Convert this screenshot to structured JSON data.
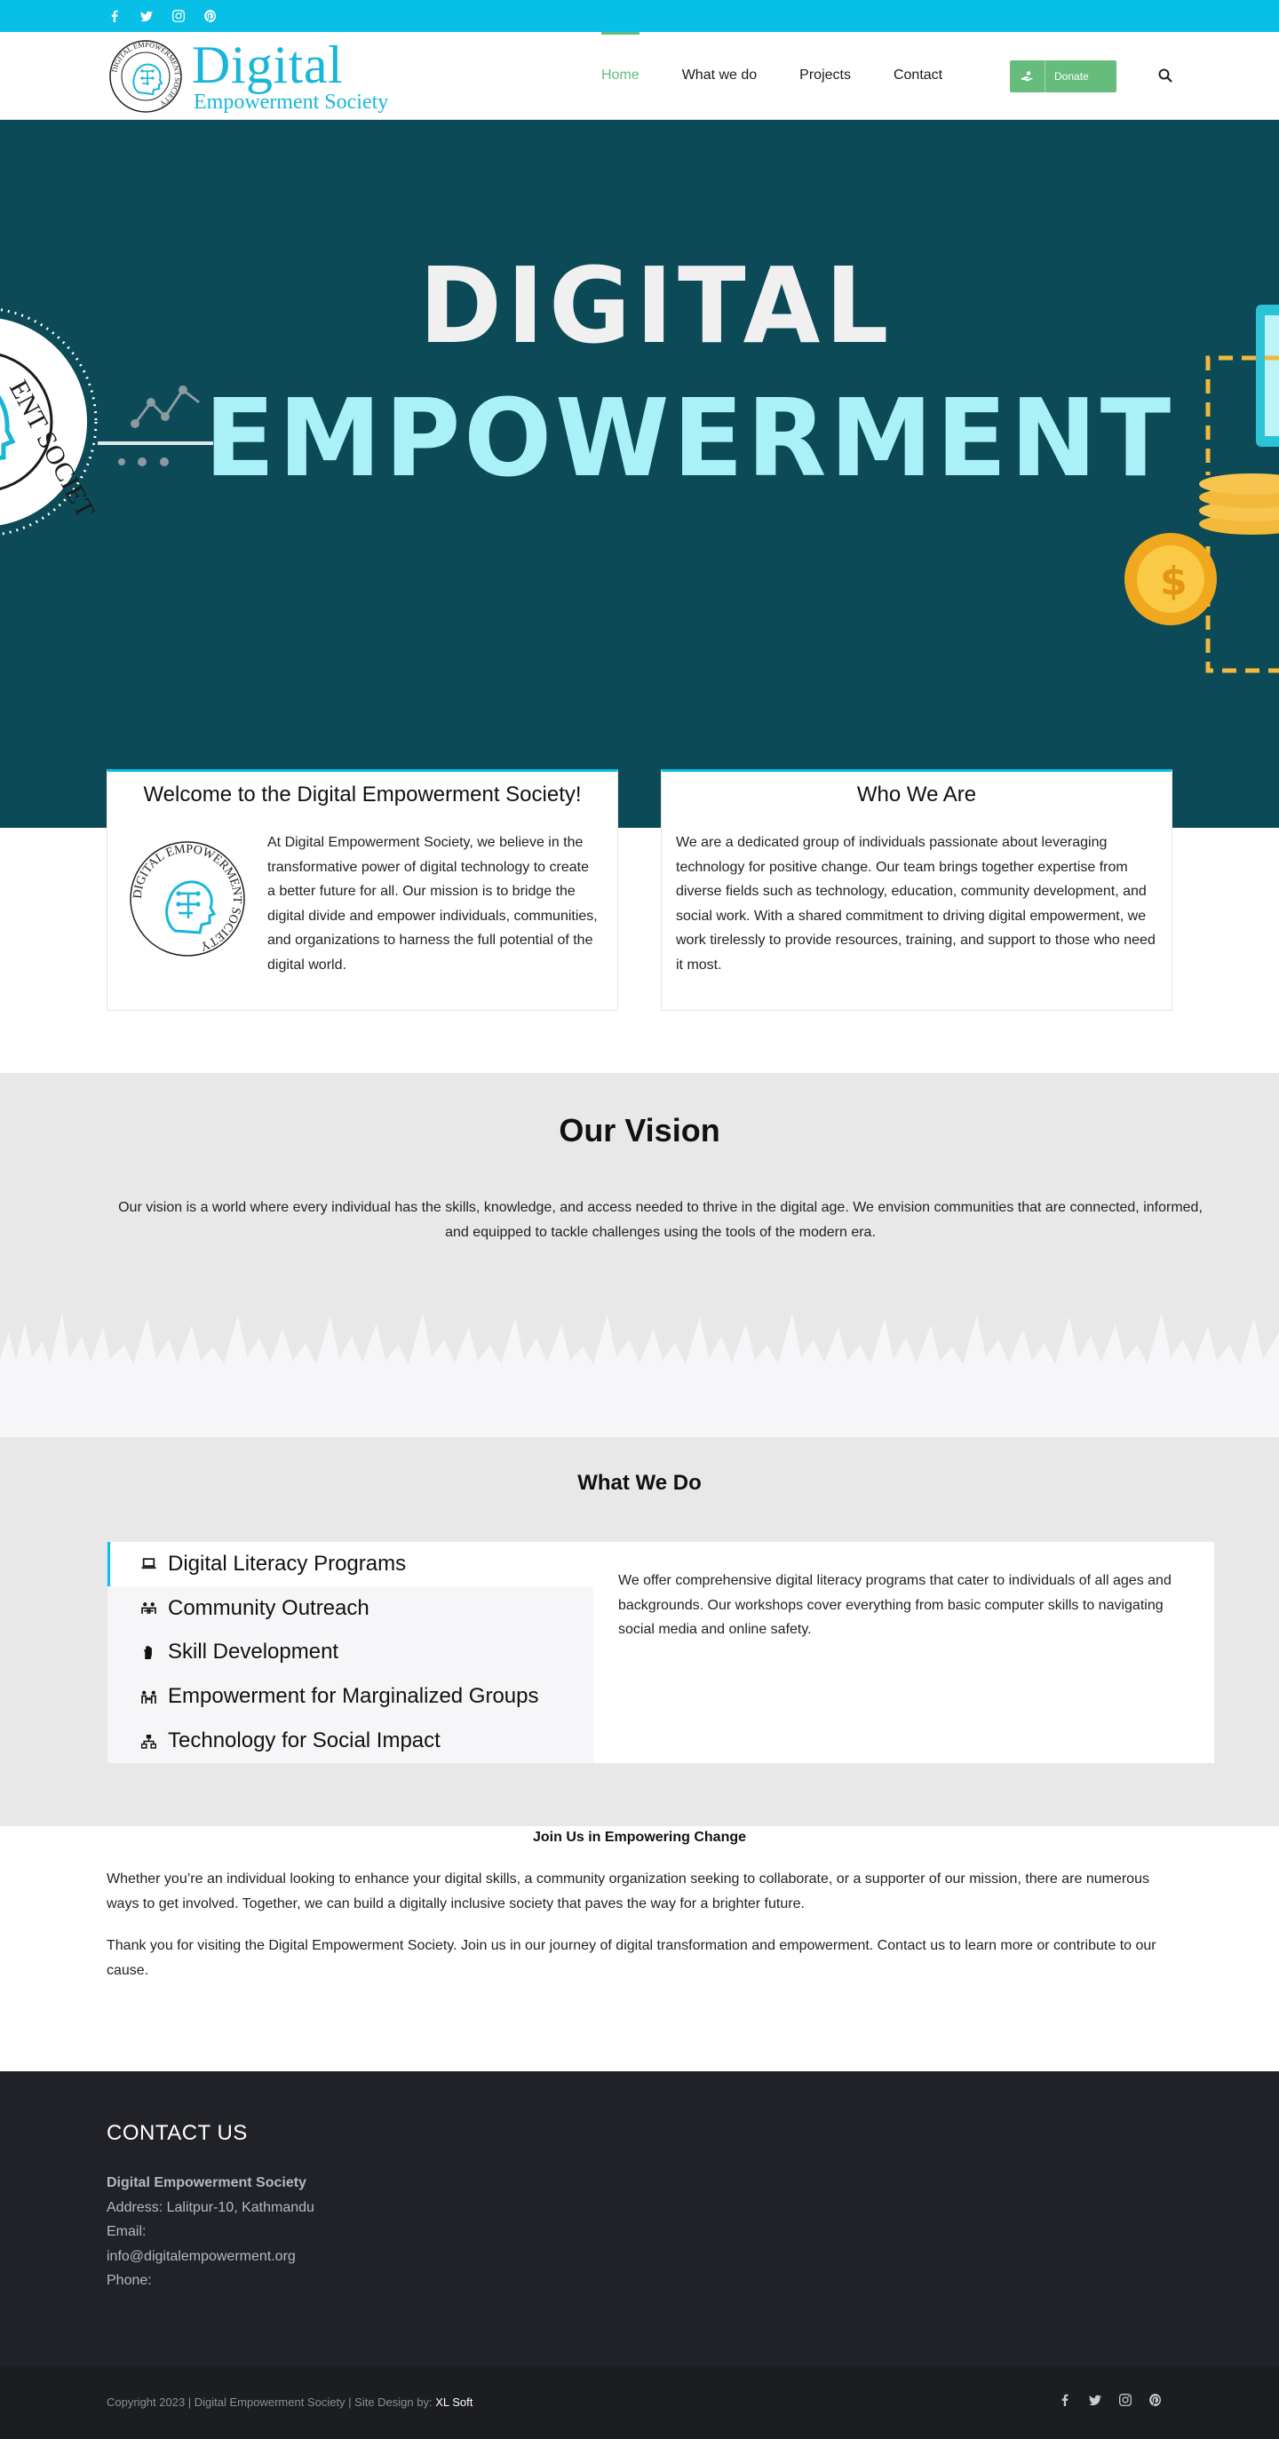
{
  "topbar": {
    "social": [
      "facebook-icon",
      "twitter-icon",
      "instagram-icon",
      "pinterest-icon"
    ],
    "background": "#08bfe6"
  },
  "header": {
    "logo": {
      "word": "Digital",
      "subtitle": "Empowerment Society",
      "seal_text": "DIGITAL EMPOWERMENT SOCIETY"
    },
    "nav": [
      {
        "label": "Home",
        "active": true
      },
      {
        "label": "What we do",
        "active": false
      },
      {
        "label": "Projects",
        "active": false
      },
      {
        "label": "Contact",
        "active": false
      }
    ],
    "donate_label": "Donate",
    "accent": "#65bc7b"
  },
  "hero": {
    "line1": "DIGITAL",
    "line2": "EMPOWERMENT",
    "background": "#0b4a56"
  },
  "cards": {
    "welcome": {
      "title": "Welcome to the Digital Empowerment Society!",
      "text": "At Digital Empowerment Society, we believe in the transformative power of digital technology to create a better future for all. Our mission is to bridge the digital divide and empower individuals, communities, and organizations to harness the full potential of the digital world."
    },
    "who": {
      "title": "Who We Are",
      "text": "We are a dedicated group of individuals passionate about leveraging technology for positive change. Our team brings together expertise from diverse fields such as technology, education, community development, and social work. With a shared commitment to driving digital empowerment, we work tirelessly to provide resources, training, and support to those who need it most."
    }
  },
  "vision": {
    "title": "Our Vision",
    "text": "Our vision is a world where every individual has the skills, knowledge, and access needed to thrive in the digital age. We envision communities that are connected, informed, and equipped to tackle challenges using the tools of the modern era."
  },
  "what_we_do": {
    "title": "What We Do",
    "tabs": [
      {
        "label": "Digital Literacy Programs",
        "icon": "laptop-icon",
        "active": true
      },
      {
        "label": "Community Outreach",
        "icon": "people-icon",
        "active": false
      },
      {
        "label": "Skill Development",
        "icon": "hand-icon",
        "active": false
      },
      {
        "label": "Empowerment for Marginalized Groups",
        "icon": "people-arrows-icon",
        "active": false
      },
      {
        "label": "Technology for Social Impact",
        "icon": "sitemap-icon",
        "active": false
      }
    ],
    "panel_text": "We offer comprehensive digital literacy programs that cater to individuals of all ages and backgrounds. Our workshops cover everything from basic computer skills to navigating social media and online safety."
  },
  "join": {
    "title": "Join Us in Empowering Change",
    "p1": "Whether you’re an individual looking to enhance your digital skills, a community organization seeking to collaborate, or a supporter of our mission, there are numerous ways to get involved. Together, we can build a digitally inclusive society that paves the way for a brighter future.",
    "p2": "Thank you for visiting the Digital Empowerment Society. Join us in our journey of digital transformation and empowerment. Contact us to learn more or contribute to our cause."
  },
  "footer": {
    "title": "CONTACT US",
    "org": "Digital Empowerment Society",
    "address": "Address: Lalitpur-10, Kathmandu",
    "email_label": "Email:",
    "email": "info@digitalempowerment.org",
    "phone_label": "Phone:"
  },
  "copyright": {
    "text": "Copyright 2023 | Digital Empowerment Society | Site Design by: ",
    "designer": "XL Soft",
    "social": [
      "facebook-icon",
      "twitter-icon",
      "instagram-icon",
      "pinterest-icon"
    ]
  }
}
